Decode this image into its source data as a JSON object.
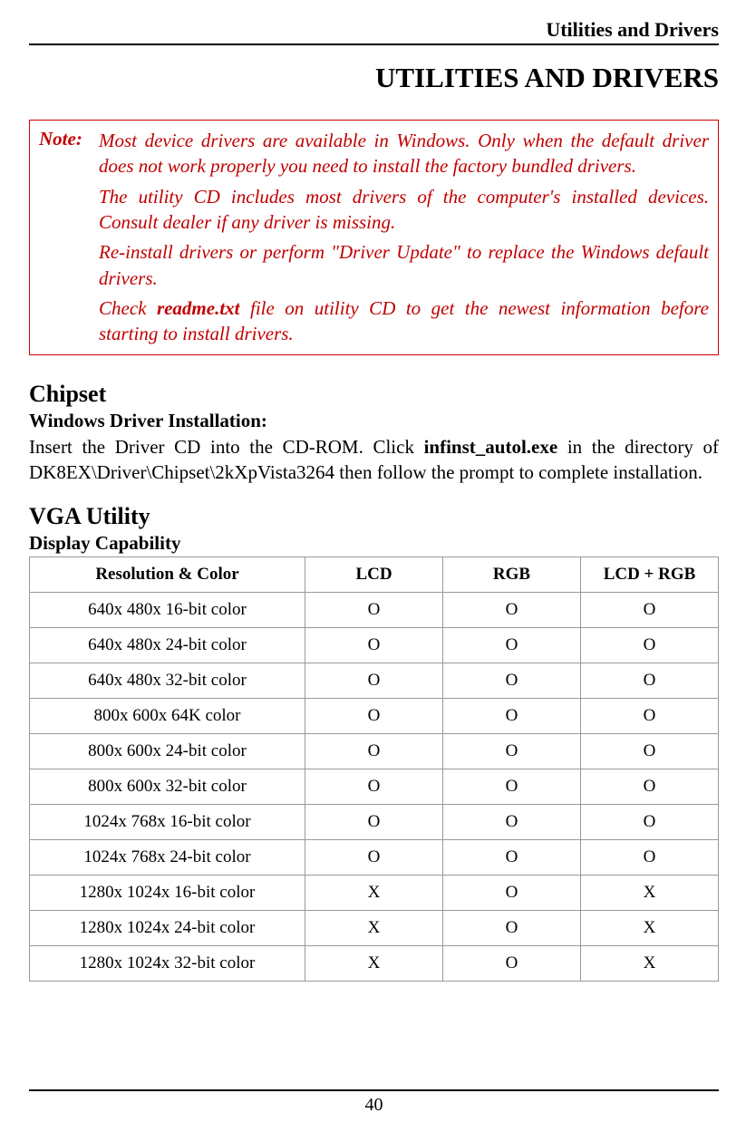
{
  "header": "Utilities and Drivers",
  "title": "UTILITIES AND DRIVERS",
  "note": {
    "label": "Note:",
    "para1": "Most device drivers are available in Windows. Only when the default driver does not work properly you need to install the factory bundled drivers.",
    "para2": "The utility CD includes most drivers of the computer's installed devices. Consult dealer if any driver is missing.",
    "para3": "Re-install drivers or perform \"Driver Update\" to replace the Windows default drivers.",
    "para4_pre": "Check ",
    "para4_bold": "readme.txt",
    "para4_post": " file on utility CD to get the newest information before starting to install drivers."
  },
  "chipset": {
    "heading": "Chipset",
    "subheading": "Windows Driver Installation:",
    "text_pre": "Insert the Driver CD into the CD-ROM. Click ",
    "text_bold": "infinst_autol.exe",
    "text_post": " in the directory of DK8EX\\Driver\\Chipset\\2kXpVista3264 then follow the prompt to complete installation."
  },
  "vga": {
    "heading": "VGA Utility",
    "subheading": "Display Capability",
    "table": {
      "headers": [
        "Resolution & Color",
        "LCD",
        "RGB",
        "LCD + RGB"
      ],
      "rows": [
        [
          "640x 480x 16-bit color",
          "O",
          "O",
          "O"
        ],
        [
          "640x 480x 24-bit color",
          "O",
          "O",
          "O"
        ],
        [
          "640x 480x 32-bit color",
          "O",
          "O",
          "O"
        ],
        [
          "800x 600x 64K color",
          "O",
          "O",
          "O"
        ],
        [
          "800x 600x 24-bit color",
          "O",
          "O",
          "O"
        ],
        [
          "800x 600x 32-bit color",
          "O",
          "O",
          "O"
        ],
        [
          "1024x 768x 16-bit color",
          "O",
          "O",
          "O"
        ],
        [
          "1024x 768x 24-bit color",
          "O",
          "O",
          "O"
        ],
        [
          "1280x 1024x 16-bit color",
          "X",
          "O",
          "X"
        ],
        [
          "1280x 1024x 24-bit color",
          "X",
          "O",
          "X"
        ],
        [
          "1280x 1024x 32-bit color",
          "X",
          "O",
          "X"
        ]
      ]
    }
  },
  "page_number": "40"
}
